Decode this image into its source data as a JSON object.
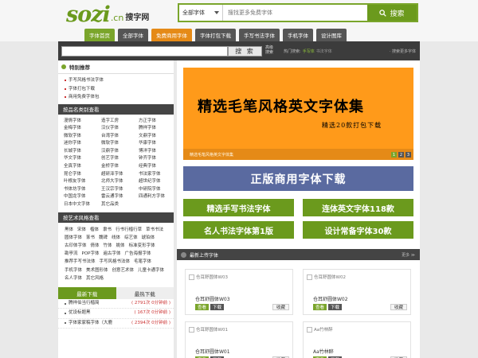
{
  "header": {
    "logo": {
      "main": "sozi",
      "cn": ".cn",
      "zh": "搜字网"
    },
    "search": {
      "category": "全部字体",
      "placeholder": "搜找更多免费字体",
      "button": "搜索"
    }
  },
  "nav": [
    {
      "label": "字体首页",
      "state": "active"
    },
    {
      "label": "全部字体",
      "state": ""
    },
    {
      "label": "免费商用字体",
      "state": "free"
    },
    {
      "label": "字体打包下载",
      "state": ""
    },
    {
      "label": "手写书法字体",
      "state": ""
    },
    {
      "label": "手机字体",
      "state": ""
    },
    {
      "label": "设计图库",
      "state": ""
    }
  ],
  "subbar": {
    "search_button": "搜 索",
    "advanced_line1": "高级",
    "advanced_line2": "搜索",
    "hot_label": "热门搜索:",
    "hot_links": [
      "手写体",
      "书法字体"
    ],
    "more": "· 搜索更多字体"
  },
  "recommend": {
    "title": "特别推荐",
    "items": [
      "手写风格书法字体",
      "字体打包下载",
      "商用免费字体包"
    ]
  },
  "categories": {
    "title": "按品名类别查看",
    "items": [
      "漫情字体",
      "造字工房",
      "方正字体",
      "金梅字体",
      "汉仪字体",
      "腾祥字体",
      "微软字体",
      "台湾字体",
      "文鼎字体",
      "迷你字体",
      "微软字体",
      "华康字体",
      "长城字体",
      "汉鼎字体",
      "博洋字体",
      "华文字体",
      "创艺字体",
      "钟齐字体",
      "全真字体",
      "金桥字体",
      "经典字体",
      "昆仑字体",
      "超研泽字体",
      "书法家字体",
      "叶根友字体",
      "北师大字体",
      "超世纪字体",
      "书体坊字体",
      "王汉宗字体",
      "中研院字体",
      "中国龙字体",
      "雷云通字体",
      "四通利方字体",
      "日本中文字体",
      "其它品类",
      ""
    ]
  },
  "styles": {
    "title": "按艺术风格查看",
    "items": [
      "黑体",
      "宋体",
      "楷体",
      "隶书",
      "行书行楷行草",
      "草书书法",
      "圆体字体",
      "篆书",
      "魏碑",
      "线体",
      "综艺体",
      "琥珀体",
      "古印体字体",
      "倩体",
      "竹体",
      "姚体",
      "标准变形字体",
      "勘亭流",
      "POP字体",
      "遍古字体",
      "广告海报字体",
      "推荐手写书法体",
      "手写风格书法体",
      "毛笔字体",
      "手机字体",
      "美术图形体",
      "创意艺术体",
      "儿童卡通字体",
      "名人字体",
      "其它风格"
    ]
  },
  "downloads": {
    "tab_new": "最新下载",
    "tab_hot": "最热下载",
    "items": [
      {
        "name": "腾祥伯当行楷简",
        "count": "( 2791次 0分钟前 )"
      },
      {
        "name": "优设标题黑",
        "count": "( 167次 0分钟前 )"
      },
      {
        "name": "字体家家稿字体（大鹿",
        "count": "( 2394次 0分钟前 )"
      }
    ]
  },
  "banner": {
    "title": "精选毛笔风格英文字体集",
    "subtitle": "精选20款打包下载",
    "caption": "精选毛笔风格英文字体集",
    "pages": [
      "1",
      "2",
      "3"
    ]
  },
  "pro_banner": "正版商用字体下载",
  "green_buttons": [
    "精选手写书法字体",
    "连体英文字体118款",
    "名人书法字体第1版",
    "设计常备字体30款"
  ],
  "uploads": {
    "title": "最新上传字体",
    "more": "更多 ≫",
    "cards": [
      {
        "thumb": "仓耳舒圆体W03",
        "name": "仓耳舒圆体W03",
        "view": "查看",
        "download": "下载",
        "fav": "收藏"
      },
      {
        "thumb": "仓耳舒圆体W02",
        "name": "仓耳舒圆体W02",
        "view": "查看",
        "download": "下载",
        "fav": "收藏"
      },
      {
        "thumb": "仓耳舒圆体W01",
        "name": "仓耳舒圆体W01",
        "view": "查看",
        "download": "下载",
        "fav": "收藏"
      },
      {
        "thumb": "Aa竹林醉",
        "name": "Aa竹林醉",
        "view": "查看",
        "download": "下载",
        "fav": "收藏"
      }
    ]
  },
  "colors": {
    "brand_green": "#6b9a1d",
    "orange": "#ff9a1a",
    "navy": "#5a6aa0",
    "dark": "#3c3c3c"
  }
}
